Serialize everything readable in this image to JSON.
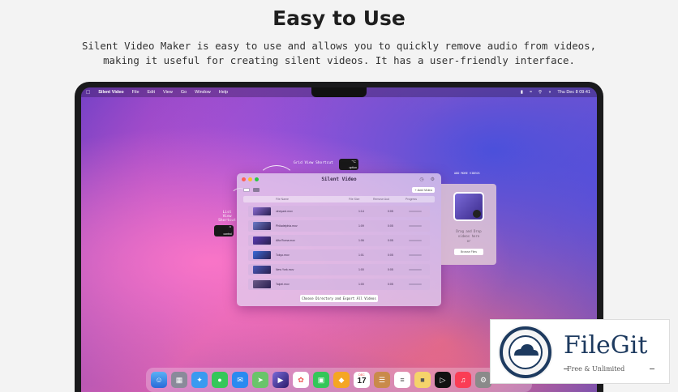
{
  "page": {
    "heading": "Easy to Use",
    "description_line1": "Silent Video Maker is easy to use and allows you to quickly remove audio from videos,",
    "description_line2": "making it useful for creating silent videos. It has a user-friendly interface."
  },
  "menubar": {
    "app": "Silent Video",
    "menus": [
      "File",
      "Edit",
      "View",
      "Go",
      "Window",
      "Help"
    ],
    "clock": "Thu Dec 8  09:41"
  },
  "app_window": {
    "title": "Silent Video",
    "add_button": "+ Add Video",
    "columns": [
      "File Name",
      "File Size",
      "Remove Aud",
      "Progress"
    ],
    "rows": [
      {
        "name": "vineyard.mov",
        "duration": "1:14",
        "audio": "0:05",
        "thumb": "#8a6ad0"
      },
      {
        "name": "Philadelphia.mov",
        "duration": "1:09",
        "audio": "0:05",
        "thumb": "#6a7ac8"
      },
      {
        "name": "Alfa Roma.mov",
        "duration": "1:06",
        "audio": "0:05",
        "thumb": "#5a3ab0"
      },
      {
        "name": "Tokyo.mov",
        "duration": "1:01",
        "audio": "0:05",
        "thumb": "#3a6ad8"
      },
      {
        "name": "New York.mov",
        "duration": "1:00",
        "audio": "0:05",
        "thumb": "#4a5ab8"
      },
      {
        "name": "Taipei.mov",
        "duration": "1:00",
        "audio": "0:05",
        "thumb": "#6a5a88"
      }
    ],
    "export_button": "Choose Directory and Export All Videos"
  },
  "annotations": {
    "grid_view_shortcut": "Grid View Shortcut",
    "list_view_line1": "List View",
    "list_view_line2": "Shortcut",
    "option_key": "option",
    "control_key": "control",
    "add_more_videos": "ADD MORE VIDEOS"
  },
  "drop_card": {
    "text_line1": "Drag and Drop",
    "text_line2": "videos here",
    "or": "or",
    "button": "Browse Files"
  },
  "dock": {
    "calendar_month": "DEC",
    "calendar_day": "17",
    "icons": [
      "finder-icon",
      "launchpad-icon",
      "safari-icon",
      "messages-icon",
      "mail-icon",
      "maps-icon",
      "silent-video-icon",
      "photos-icon",
      "facetime-icon",
      "sketch-icon",
      "calendar-icon",
      "notes-icon",
      "reminders-icon",
      "tv-icon",
      "music-icon",
      "settings-icon"
    ]
  },
  "watermark": {
    "brand": "FileGit",
    "tagline": "Free & Unlimited"
  }
}
